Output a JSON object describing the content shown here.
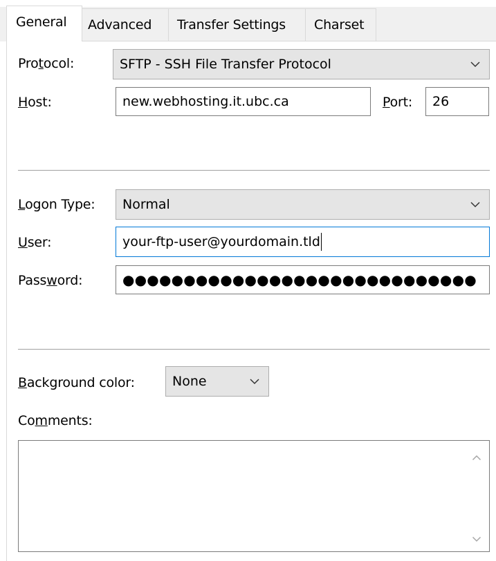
{
  "tabs": [
    {
      "label": "General",
      "active": true
    },
    {
      "label": "Advanced",
      "active": false
    },
    {
      "label": "Transfer Settings",
      "active": false
    },
    {
      "label": "Charset",
      "active": false
    }
  ],
  "protocol": {
    "label_pre": "Pro",
    "label_accel": "t",
    "label_post": "ocol:",
    "value": "SFTP - SSH File Transfer Protocol"
  },
  "host": {
    "label_accel": "H",
    "label_post": "ost:",
    "value": "new.webhosting.it.ubc.ca"
  },
  "port": {
    "label_accel": "P",
    "label_post": "ort:",
    "value": "26"
  },
  "logon_type": {
    "label_accel": "L",
    "label_post": "ogon Type:",
    "value": "Normal"
  },
  "user": {
    "label_accel": "U",
    "label_post": "ser:",
    "value": "your-ftp-user@yourdomain.tld"
  },
  "password": {
    "label_pre": "Pass",
    "label_accel": "w",
    "label_post": "ord:",
    "value": "●●●●●●●●●●●●●●●●●●●●●●●●●●●●●"
  },
  "background_color": {
    "label_accel": "B",
    "label_post": "ackground color:",
    "value": "None"
  },
  "comments": {
    "label_pre": "Co",
    "label_accel": "m",
    "label_post": "ments:",
    "value": ""
  },
  "icons": {
    "dropdown": "chevron-down-icon",
    "scroll_up": "chevron-up-icon",
    "scroll_down": "chevron-down-icon"
  },
  "colors": {
    "focus_border": "#0078d7",
    "combo_bg": "#e5e5e5",
    "tab_bg": "#f0f0f0"
  }
}
